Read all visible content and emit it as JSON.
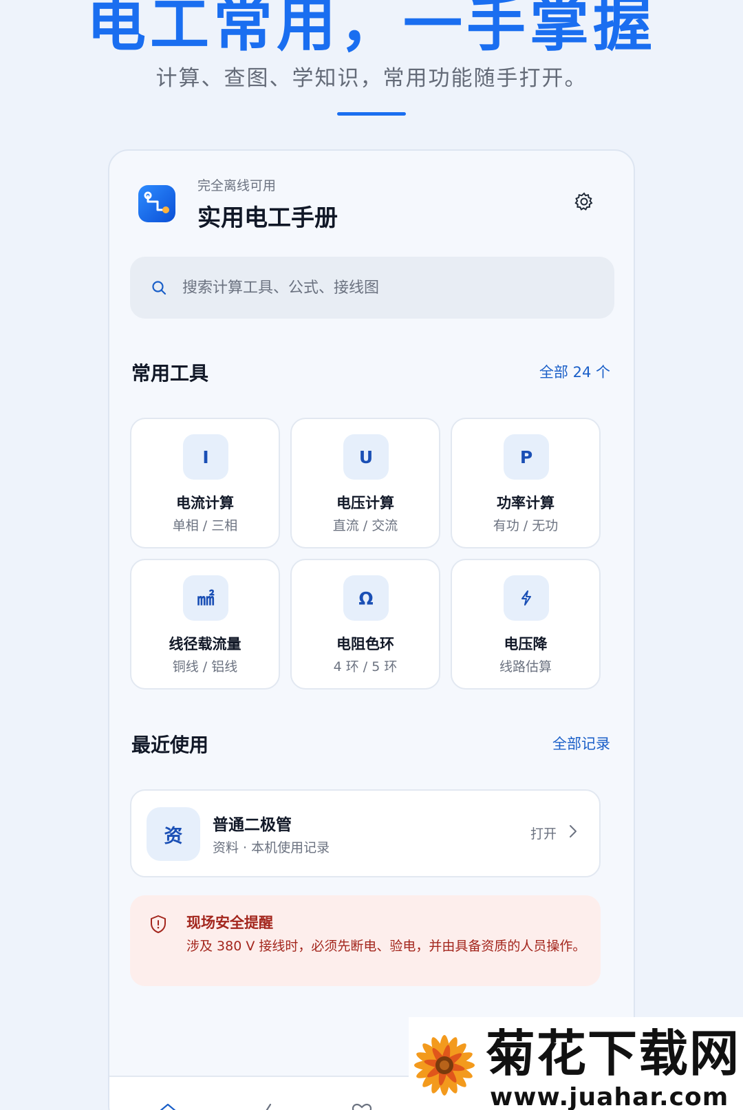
{
  "hero": {
    "title": "电工常用，一手掌握",
    "subtitle": "计算、查图、学知识，常用功能随手打开。"
  },
  "app": {
    "caption": "完全离线可用",
    "name": "实用电工手册",
    "icon": "circuit-app-icon",
    "settings_icon": "gear-icon"
  },
  "search": {
    "placeholder": "搜索计算工具、公式、接线图",
    "value": ""
  },
  "tools_section": {
    "title": "常用工具",
    "link": "全部 24 个",
    "items": [
      {
        "symbol": "I",
        "name": "电流计算",
        "desc": "单相 / 三相"
      },
      {
        "symbol": "U",
        "name": "电压计算",
        "desc": "直流 / 交流"
      },
      {
        "symbol": "P",
        "name": "功率计算",
        "desc": "有功 / 无功"
      },
      {
        "symbol": "㎟",
        "name": "线径载流量",
        "desc": "铜线 / 铝线"
      },
      {
        "symbol": "Ω",
        "name": "电阻色环",
        "desc": "4 环 / 5 环"
      },
      {
        "symbol": "bolt-icon",
        "name": "电压降",
        "desc": "线路估算"
      }
    ]
  },
  "recent_section": {
    "title": "最近使用",
    "link": "全部记录",
    "items": [
      {
        "badge": "资",
        "title": "普通二极管",
        "subtitle": "资料 · 本机使用记录",
        "action": "打开"
      }
    ]
  },
  "safety": {
    "title": "现场安全提醒",
    "body": "涉及 380 V 接线时，必须先断电、验电，并由具备资质的人员操作。"
  },
  "watermark": {
    "title": "菊花下载网",
    "url": "www.juahar.com"
  },
  "colors": {
    "accent": "#1a6ef0",
    "danger": "#a3261d",
    "background": "#eef3fb"
  }
}
